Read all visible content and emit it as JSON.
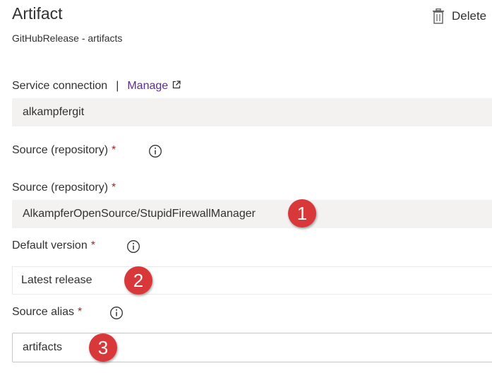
{
  "header": {
    "title": "Artifact",
    "subtitle": "GitHubRelease - artifacts",
    "delete_label": "Delete"
  },
  "form": {
    "service_connection": {
      "label": "Service connection",
      "separator": "|",
      "manage_label": "Manage",
      "value": "alkampfergit"
    },
    "source_repo_info": {
      "label": "Source (repository)",
      "required_mark": "*"
    },
    "source_repo": {
      "label": "Source (repository)",
      "required_mark": "*",
      "value": "AlkampferOpenSource/StupidFirewallManager"
    },
    "default_version": {
      "label": "Default version",
      "required_mark": "*",
      "value": "Latest release"
    },
    "source_alias": {
      "label": "Source alias",
      "required_mark": "*",
      "value": "artifacts"
    }
  },
  "callouts": [
    "1",
    "2",
    "3"
  ],
  "colors": {
    "accent_link": "#5c2d91",
    "required": "#a4262c",
    "callout": "#d9383a"
  },
  "icons": {
    "delete": "trash-icon",
    "manage": "external-link-icon",
    "info": "info-icon"
  }
}
